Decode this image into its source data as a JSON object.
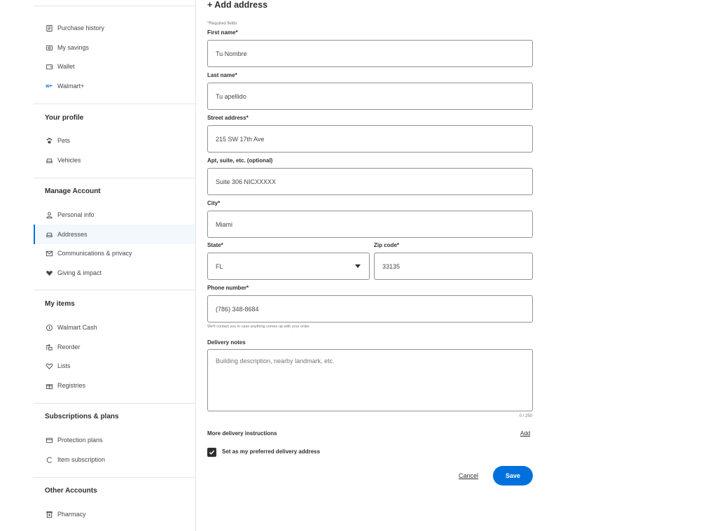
{
  "sidebar": {
    "account_items": [
      {
        "icon": "receipt-icon",
        "label": "Purchase history"
      },
      {
        "icon": "savings-icon",
        "label": "My savings"
      },
      {
        "icon": "wallet-icon",
        "label": "Wallet"
      },
      {
        "icon": "walmart-plus-icon",
        "icon_text": "w+",
        "label": "Walmart+"
      }
    ],
    "profile_heading": "Your profile",
    "profile_items": [
      {
        "icon": "paw-icon",
        "label": "Pets"
      },
      {
        "icon": "car-icon",
        "label": "Vehicles"
      }
    ],
    "manage_heading": "Manage Account",
    "manage_items": [
      {
        "icon": "person-icon",
        "label": "Personal info"
      },
      {
        "icon": "address-icon",
        "label": "Addresses",
        "active": true
      },
      {
        "icon": "mail-icon",
        "label": "Communications & privacy"
      },
      {
        "icon": "heart-hand-icon",
        "label": "Giving & impact"
      }
    ],
    "items_heading": "My items",
    "items_items": [
      {
        "icon": "cash-icon",
        "label": "Walmart Cash"
      },
      {
        "icon": "reorder-icon",
        "label": "Reorder"
      },
      {
        "icon": "heart-icon",
        "label": "Lists"
      },
      {
        "icon": "gift-icon",
        "label": "Registries"
      }
    ],
    "subs_heading": "Subscriptions & plans",
    "subs_items": [
      {
        "icon": "shield-icon",
        "label": "Protection plans"
      },
      {
        "icon": "refresh-icon",
        "label": "Item subscription"
      }
    ],
    "other_heading": "Other Accounts",
    "other_items": [
      {
        "icon": "pharmacy-icon",
        "label": "Pharmacy"
      }
    ]
  },
  "form": {
    "title": "+ Add address",
    "required_note": "*Required fields",
    "first_name": {
      "label": "First name*",
      "value": "Tu Nombre"
    },
    "last_name": {
      "label": "Last name*",
      "value": "Tu apellido"
    },
    "street": {
      "label": "Street address*",
      "value": "215 SW 17th Ave"
    },
    "apt": {
      "label": "Apt, suite, etc. (optional)",
      "value": "Suite 306 NICXXXXX"
    },
    "city": {
      "label": "City*",
      "value": "Miami"
    },
    "state": {
      "label": "State*",
      "value": "FL"
    },
    "zip": {
      "label": "Zip code*",
      "value": "33135"
    },
    "phone": {
      "label": "Phone number*",
      "value": "(786) 348-8684",
      "help": "We'll contact you in case anything comes up with your order."
    },
    "notes": {
      "label": "Delivery notes",
      "placeholder": "Building description, nearby landmark, etc.",
      "counter": "0 / 250"
    },
    "more_instructions": {
      "label": "More delivery instructions",
      "link": "Add"
    },
    "preferred": {
      "label": "Set as my preferred delivery address",
      "checked": true
    },
    "cancel": "Cancel",
    "save": "Save"
  },
  "colors": {
    "primary": "#0071dc",
    "text": "#2e2f32",
    "border": "#909196"
  }
}
